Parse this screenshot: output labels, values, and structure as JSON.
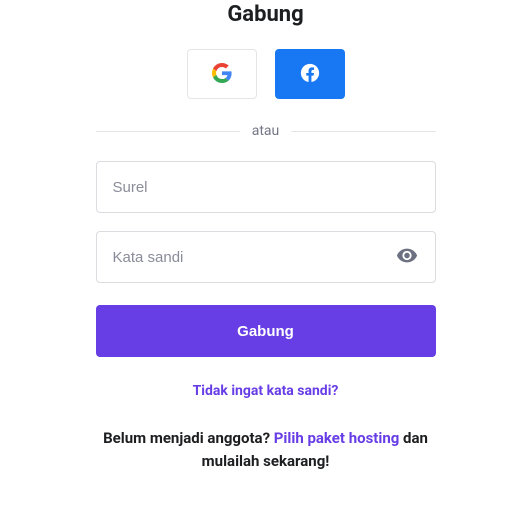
{
  "title": "Gabung",
  "social": {
    "google": "google",
    "facebook": "facebook"
  },
  "divider": "atau",
  "form": {
    "email_placeholder": "Surel",
    "password_placeholder": "Kata sandi",
    "submit_label": "Gabung"
  },
  "forgot_label": "Tidak ingat kata sandi?",
  "signup": {
    "prefix": "Belum menjadi anggota? ",
    "link": "Pilih paket hosting",
    "suffix": " dan mulailah sekarang!"
  }
}
